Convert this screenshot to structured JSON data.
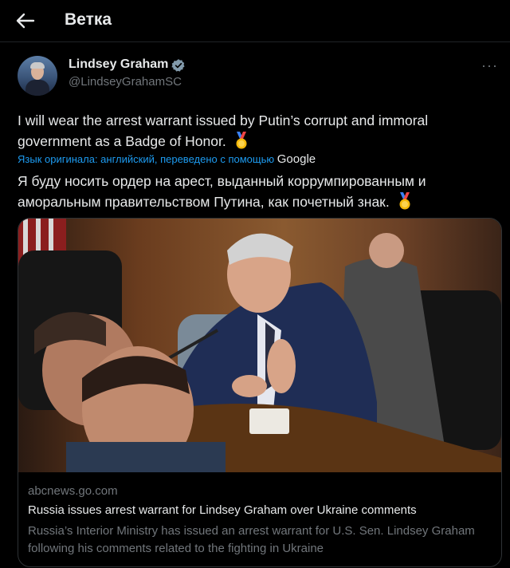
{
  "header": {
    "title": "Ветка",
    "back_icon": "arrow-left-icon"
  },
  "author": {
    "name": "Lindsey Graham",
    "handle": "@LindseyGrahamSC",
    "verified_icon": "verified-badge-icon",
    "more_icon": "more-horizontal-icon",
    "more_label": "···"
  },
  "tweet": {
    "text_original": "I will wear the arrest warrant issued by Putin’s corrupt and immoral government as a Badge of Honor.",
    "translation_note": "Язык оригинала: английский, переведено с помощью",
    "translation_provider": "Google",
    "text_translated": "Я буду носить ордер на арест, выданный коррумпированным и аморальным правительством Путина, как почетный знак.",
    "emoji_icon": "medal-icon"
  },
  "link_card": {
    "domain": "abcnews.go.com",
    "title": "Russia issues arrest warrant for Lindsey Graham over Ukraine comments",
    "description": "Russia’s Interior Ministry has issued an arrest warrant for U.S. Sen. Lindsey Graham following his comments related to the fighting in Ukraine"
  },
  "colors": {
    "background": "#000000",
    "text": "#e7e9ea",
    "muted": "#71767b",
    "link": "#1d9bf0",
    "verified": "#829aab"
  }
}
